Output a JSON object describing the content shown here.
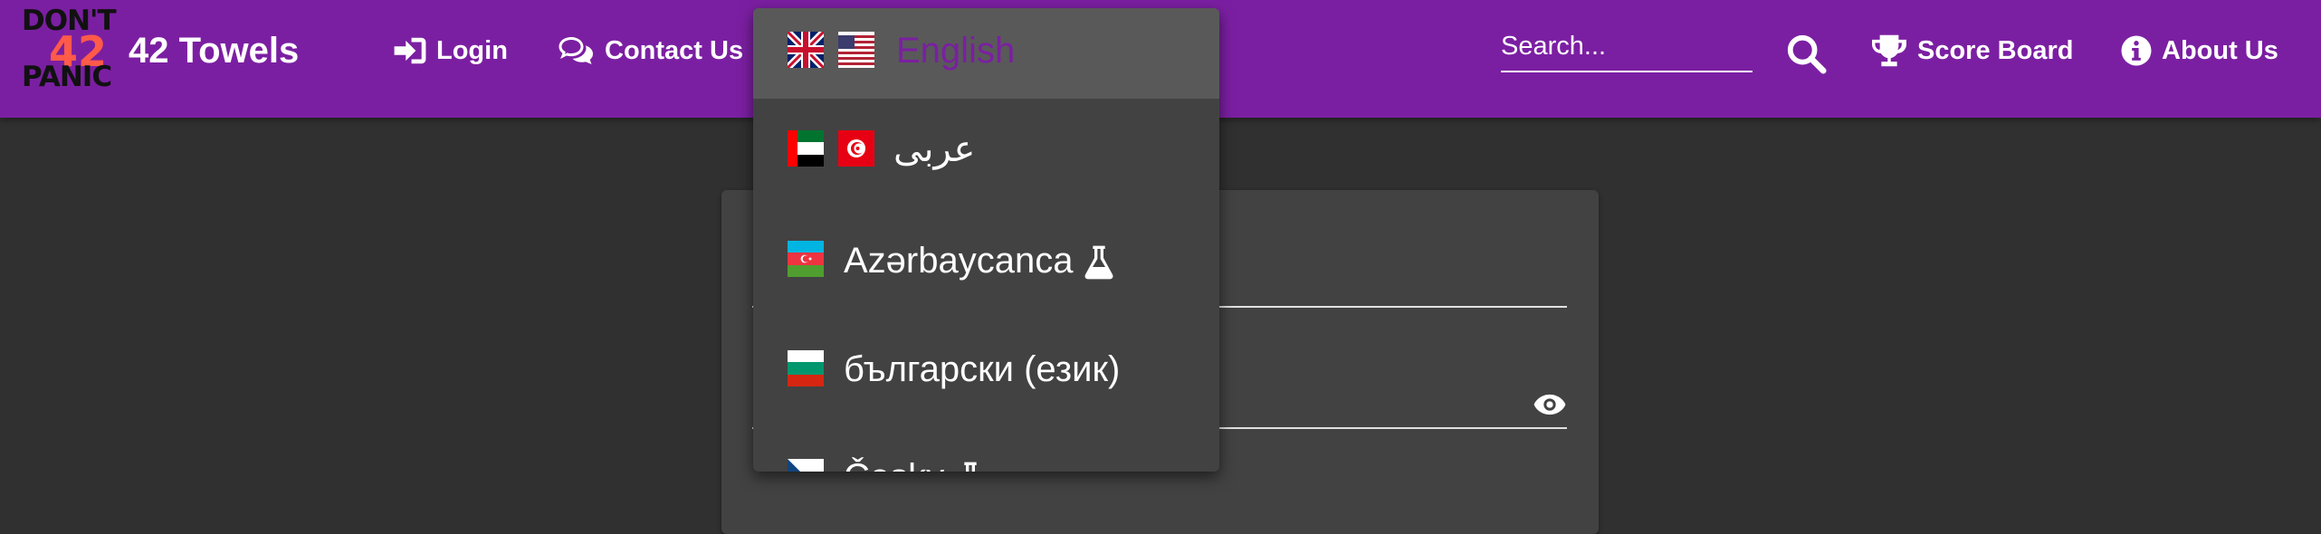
{
  "header": {
    "logo": {
      "line1": "DON'T",
      "number": "42",
      "line2": "PANIC"
    },
    "app_name": "42 Towels",
    "nav": {
      "login": "Login",
      "contact": "Contact Us",
      "score_board": "Score Board",
      "about": "About Us"
    },
    "search": {
      "placeholder": "Search..."
    }
  },
  "language_menu": {
    "items": [
      {
        "label": "English",
        "flags": [
          "uk-flag-icon",
          "us-flag-icon"
        ],
        "selected": true,
        "color": "#7b1fa2"
      },
      {
        "label": "عربى",
        "flags": [
          "uae-flag-icon",
          "tunisia-flag-icon"
        ]
      },
      {
        "label": "Azərbaycanca",
        "flags": [
          "azerbaijan-flag-icon"
        ],
        "experimental_icon": "flask-icon"
      },
      {
        "label": "български (език)",
        "flags": [
          "bulgaria-flag-icon"
        ]
      },
      {
        "label": "Česky",
        "flags": [
          "czech-flag-icon"
        ],
        "experimental_icon": "flask-icon"
      }
    ]
  },
  "login_form": {
    "password_toggle_icon": "eye-icon"
  },
  "colors": {
    "toolbar": "#7b1fa2",
    "background": "#303030",
    "card": "#424242",
    "menu": "#424242",
    "menu_selected": "#595959"
  }
}
